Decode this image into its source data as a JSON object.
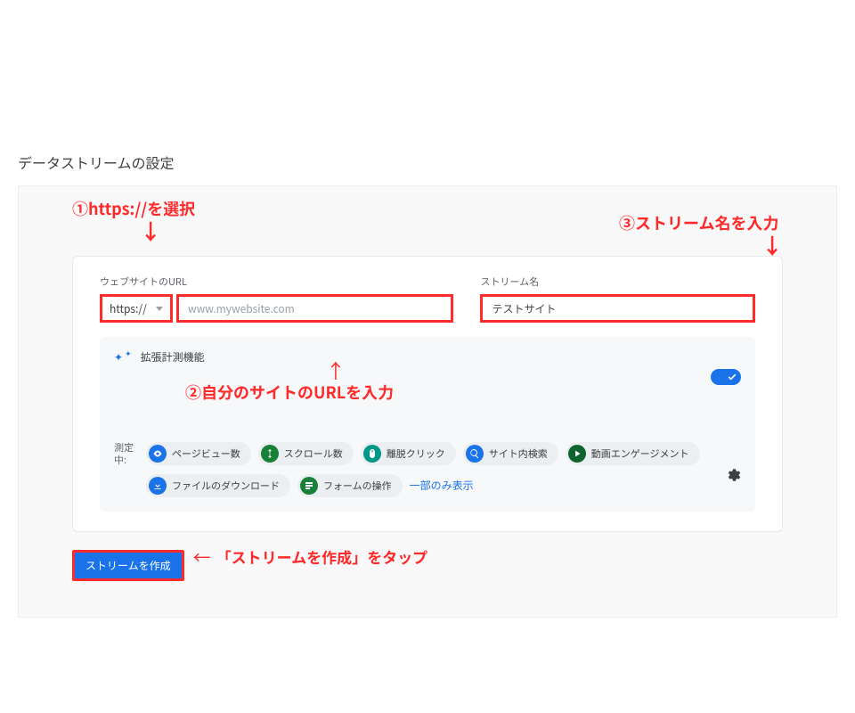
{
  "page_title": "データストリームの設定",
  "annotations": {
    "step1": "①https://を選択",
    "step2": "②自分のサイトのURLを入力",
    "step3": "③ストリーム名を入力",
    "tap": "「ストリームを作成」をタップ"
  },
  "form": {
    "url_label": "ウェブサイトのURL",
    "protocol_value": "https://",
    "url_placeholder": "www.mywebsite.com",
    "stream_label": "ストリーム名",
    "stream_value": "テストサイト"
  },
  "enhanced": {
    "title": "拡張計測機能",
    "measuring_label": "測定中:",
    "chips1": [
      "ページビュー数",
      "スクロール数",
      "離脱クリック",
      "サイト内検索",
      "動画エンゲージメント"
    ],
    "chips2": [
      "ファイルのダウンロード",
      "フォームの操作"
    ],
    "show_partial": "一部のみ表示"
  },
  "create_button_label": "ストリームを作成",
  "icons": {
    "eye": "eye-icon",
    "scroll": "scroll-icon",
    "mouse": "mouse-icon",
    "search": "search-icon",
    "play": "play-icon",
    "download": "download-icon",
    "form": "form-icon",
    "gear": "gear-icon",
    "check": "check-icon"
  }
}
